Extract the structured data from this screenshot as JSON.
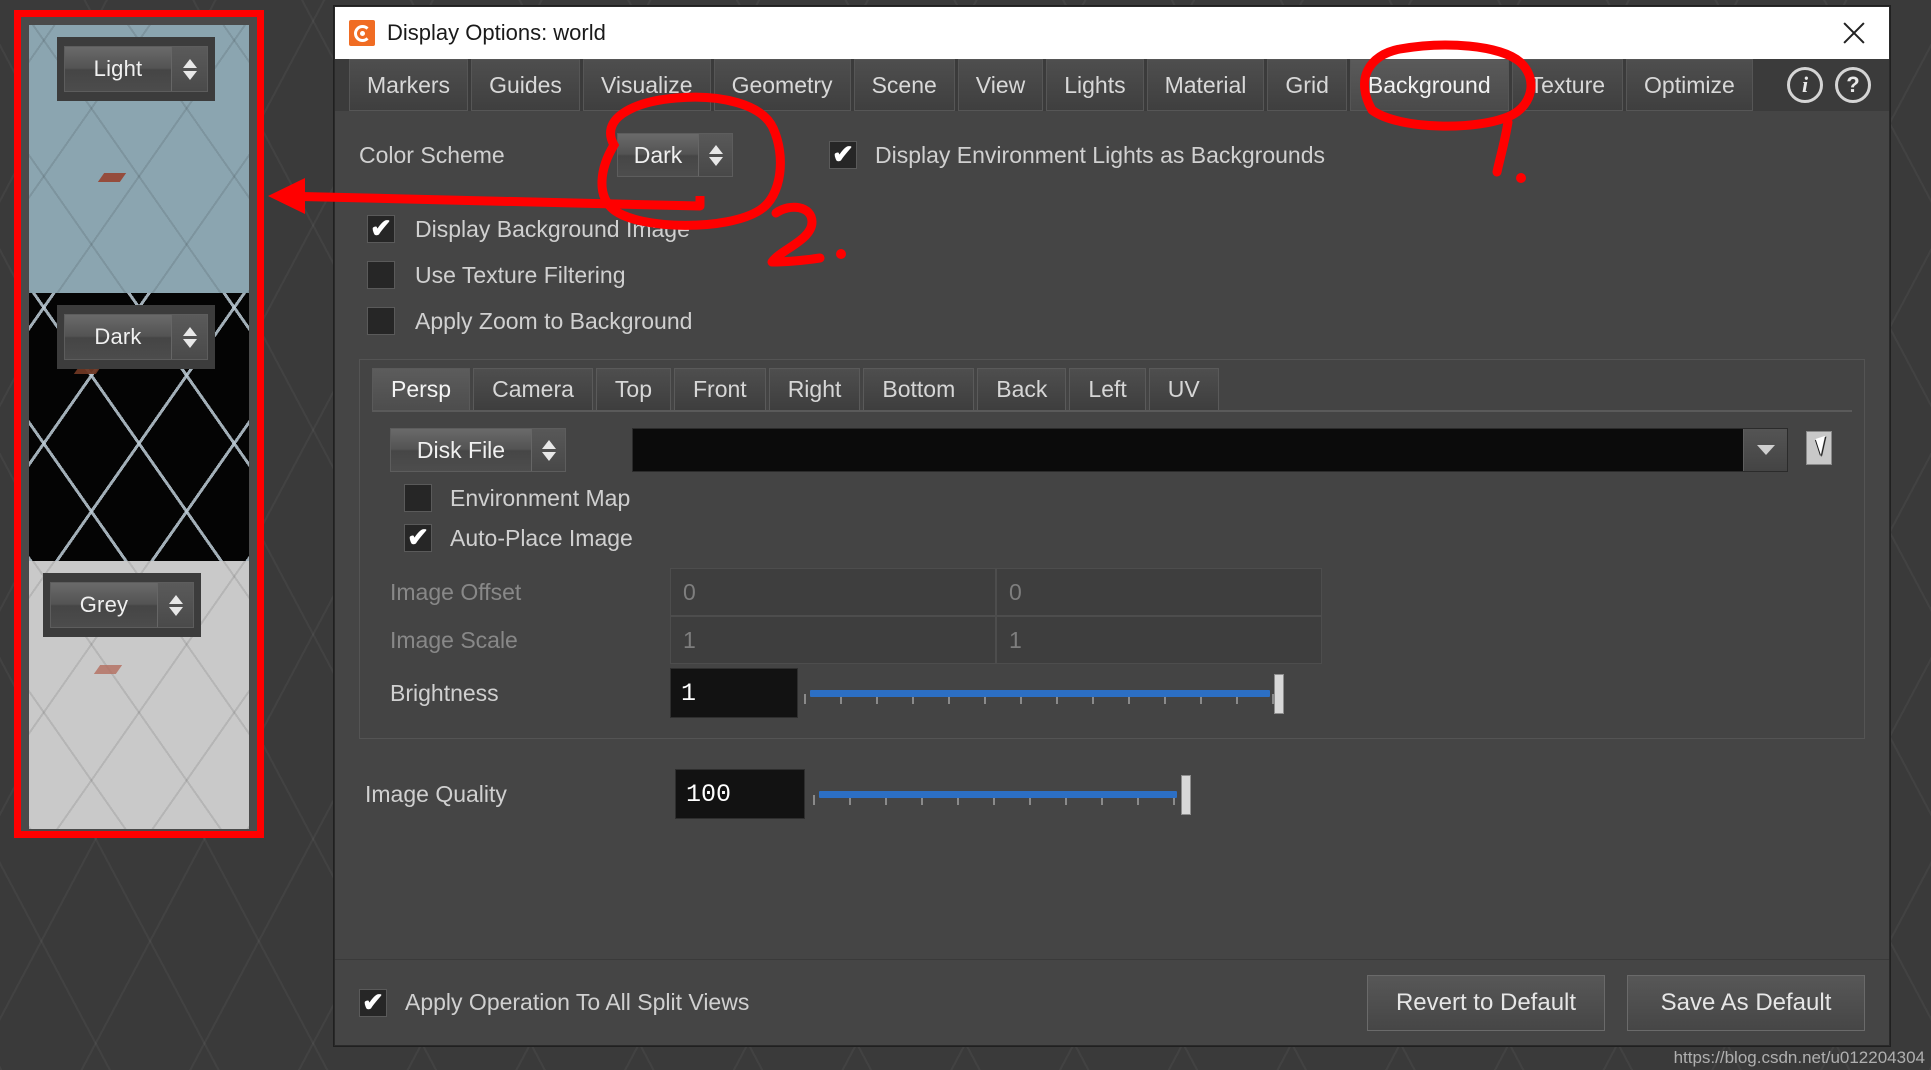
{
  "window": {
    "title": "Display Options:  world",
    "app_icon": "spiral-icon",
    "close_icon": "close-icon"
  },
  "tabs": [
    {
      "label": "Markers",
      "active": false
    },
    {
      "label": "Guides",
      "active": false
    },
    {
      "label": "Visualize",
      "active": false
    },
    {
      "label": "Geometry",
      "active": false
    },
    {
      "label": "Scene",
      "active": false
    },
    {
      "label": "View",
      "active": false
    },
    {
      "label": "Lights",
      "active": false
    },
    {
      "label": "Material",
      "active": false
    },
    {
      "label": "Grid",
      "active": false
    },
    {
      "label": "Background",
      "active": true
    },
    {
      "label": "Texture",
      "active": false
    },
    {
      "label": "Optimize",
      "active": false
    }
  ],
  "tab_icons": [
    {
      "name": "info-icon",
      "glyph": "i"
    },
    {
      "name": "help-icon",
      "glyph": "?"
    }
  ],
  "color_scheme": {
    "label": "Color Scheme",
    "value": "Dark",
    "options": [
      "Light",
      "Dark",
      "Grey"
    ]
  },
  "env_lights": {
    "label": "Display Environment Lights as Backgrounds",
    "checked": true
  },
  "checkboxes": [
    {
      "label": "Display Background Image",
      "checked": true
    },
    {
      "label": "Use Texture Filtering",
      "checked": false
    },
    {
      "label": "Apply Zoom to Background",
      "checked": false
    }
  ],
  "view_tabs": [
    {
      "label": "Persp",
      "active": true
    },
    {
      "label": "Camera",
      "active": false
    },
    {
      "label": "Top",
      "active": false
    },
    {
      "label": "Front",
      "active": false
    },
    {
      "label": "Right",
      "active": false
    },
    {
      "label": "Bottom",
      "active": false
    },
    {
      "label": "Back",
      "active": false
    },
    {
      "label": "Left",
      "active": false
    },
    {
      "label": "UV",
      "active": false
    }
  ],
  "source": {
    "value": "Disk File",
    "options": [
      "Disk File"
    ],
    "file_path": "",
    "file_placeholder": "",
    "dropdown_icon": "chevron-down-icon",
    "browse_icon": "browse-file-icon"
  },
  "image_checkboxes": [
    {
      "label": "Environment Map",
      "checked": false
    },
    {
      "label": "Auto-Place Image",
      "checked": true
    }
  ],
  "fields": {
    "image_offset": {
      "label": "Image Offset",
      "x": "0",
      "y": "0",
      "disabled": true
    },
    "image_scale": {
      "label": "Image Scale",
      "x": "1",
      "y": "1",
      "disabled": true
    },
    "brightness": {
      "label": "Brightness",
      "value": "1",
      "slider_percent": 100
    },
    "image_quality": {
      "label": "Image Quality",
      "value": "100",
      "slider_percent": 100
    }
  },
  "footer": {
    "apply_all_label": "Apply Operation To All Split Views",
    "apply_all_checked": true,
    "revert_label": "Revert to Default",
    "save_label": "Save As Default"
  },
  "watermark": "https://blog.csdn.net/u012204304",
  "previews": [
    {
      "scheme": "Light",
      "variant": "light"
    },
    {
      "scheme": "Dark",
      "variant": "dark"
    },
    {
      "scheme": "Grey",
      "variant": "grey"
    }
  ],
  "annotations": {
    "marker_1": "1",
    "marker_2": "2",
    "accent_color": "#ff0000"
  }
}
